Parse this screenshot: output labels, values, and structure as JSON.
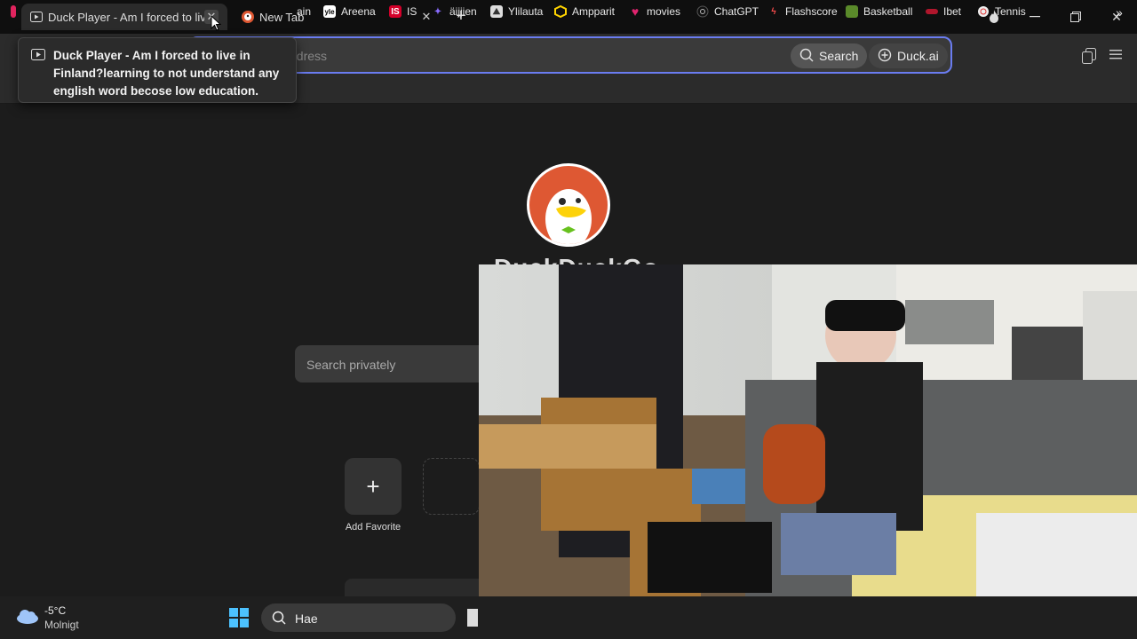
{
  "tabs": [
    {
      "title": "Duck Player - Am I forced to live in Finland?learning to not understand any english word becose low education.",
      "active": true,
      "icon": "play-icon"
    },
    {
      "title": "New Tab",
      "active": false,
      "icon": "duckduckgo-icon"
    }
  ],
  "tooltip": {
    "text": "Duck Player - Am I forced to live in Finland?learning to not understand any english word becose low education."
  },
  "address_bar": {
    "placeholder": "Search or enter address",
    "visible_placeholder": "ddress",
    "search_label": "Search",
    "duck_ai_label": "Duck.ai"
  },
  "bookmarks": [
    {
      "label": "ain",
      "icon": "bookmark-icon"
    },
    {
      "label": "Areena",
      "icon": "areena-icon"
    },
    {
      "label": "IS",
      "icon": "is-icon"
    },
    {
      "label": "äijjien",
      "icon": "aijjien-icon"
    },
    {
      "label": "Ylilauta",
      "icon": "ylilauta-icon"
    },
    {
      "label": "Ampparit",
      "icon": "ampparit-icon"
    },
    {
      "label": "movies",
      "icon": "heart-icon"
    },
    {
      "label": "ChatGPT",
      "icon": "chatgpt-icon"
    },
    {
      "label": "Flashscore",
      "icon": "flashscore-icon"
    },
    {
      "label": "Basketball",
      "icon": "basketball-icon"
    },
    {
      "label": "Ibet",
      "icon": "ibet-icon"
    },
    {
      "label": "Tennis",
      "icon": "tennis-icon"
    }
  ],
  "newtab": {
    "brand_partial": "DuckDuckGo",
    "search_placeholder": "Search privately",
    "add_favorite_label": "Add Favorite"
  },
  "taskbar": {
    "temperature": "-5°C",
    "weather": "Molnigt",
    "search_label": "Hae"
  },
  "colors": {
    "accent": "#6a7cf0",
    "duck_orange": "#de5833",
    "background": "#1c1c1c"
  }
}
